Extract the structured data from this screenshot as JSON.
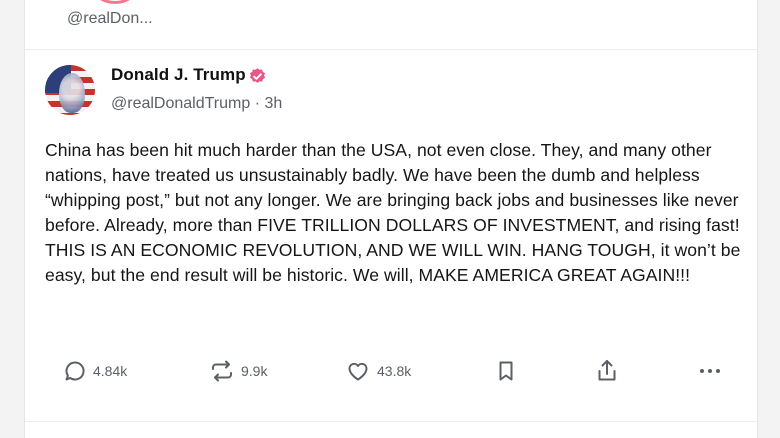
{
  "previous_post": {
    "handle": "@realDon..."
  },
  "post": {
    "author_name": "Donald J. Trump",
    "author_meta": "@realDonaldTrump · 3h",
    "text": "China has been hit much harder than the USA, not even close. They, and many other nations, have treated us unsustainably badly. We have been the dumb and helpless “whipping post,” but not any longer. We are bringing back jobs and businesses like never before. Already, more than FIVE TRILLION DOLLARS OF INVESTMENT, and rising fast! THIS IS AN ECONOMIC REVOLUTION, AND WE WILL WIN. HANG TOUGH, it won’t be easy, but the end result will be historic. We will, MAKE AMERICA GREAT AGAIN!!!",
    "actions": {
      "replies": "4.84k",
      "reposts": "9.9k",
      "likes": "43.8k"
    }
  },
  "colors": {
    "verified_badge": "#e8578a",
    "muted_text": "#5b5f66"
  },
  "icons": [
    "verified-badge-icon",
    "reply-icon",
    "repost-icon",
    "like-icon",
    "bookmark-icon",
    "share-icon",
    "more-icon"
  ]
}
